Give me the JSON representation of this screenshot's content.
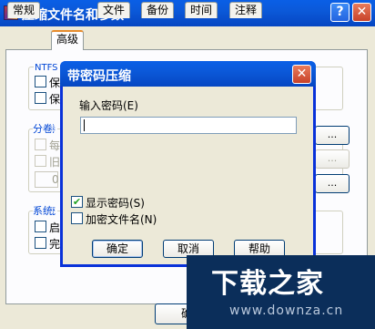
{
  "colors": {
    "title_blue": "#0b59d9",
    "dialog_face": "#ece9d8",
    "watermark_bg": "#0b2e5a"
  },
  "outer_window": {
    "title": "压缩文件名和参数",
    "help_glyph": "?",
    "close_glyph": "✕",
    "tabs": [
      "常规",
      "高级",
      "文件",
      "备份",
      "时间",
      "注释"
    ],
    "active_tab": "高级",
    "ntfs_label": "NTFS 选",
    "option_chars": [
      "保",
      "保"
    ],
    "volume_label": "分卷",
    "volume_frags": [
      "每",
      "旧"
    ],
    "volume_value": "0",
    "system_label": "系统",
    "system_frags": [
      "启",
      "完"
    ],
    "side_buttons": [
      "...",
      "...",
      "..."
    ],
    "ok_fragment": "确"
  },
  "dialog": {
    "title": "带密码压缩",
    "close_glyph": "✕",
    "password_label": "输入密码(E)",
    "password_value": "",
    "show_password": {
      "label": "显示密码(S)",
      "checked": true,
      "check_glyph": "✔"
    },
    "encrypt_names": {
      "label": "加密文件名(N)",
      "checked": false
    },
    "buttons": {
      "ok": "确定",
      "cancel": "取消",
      "help": "帮助"
    }
  },
  "watermark": {
    "logo": "下载之家",
    "url": "www.downza.cn"
  }
}
